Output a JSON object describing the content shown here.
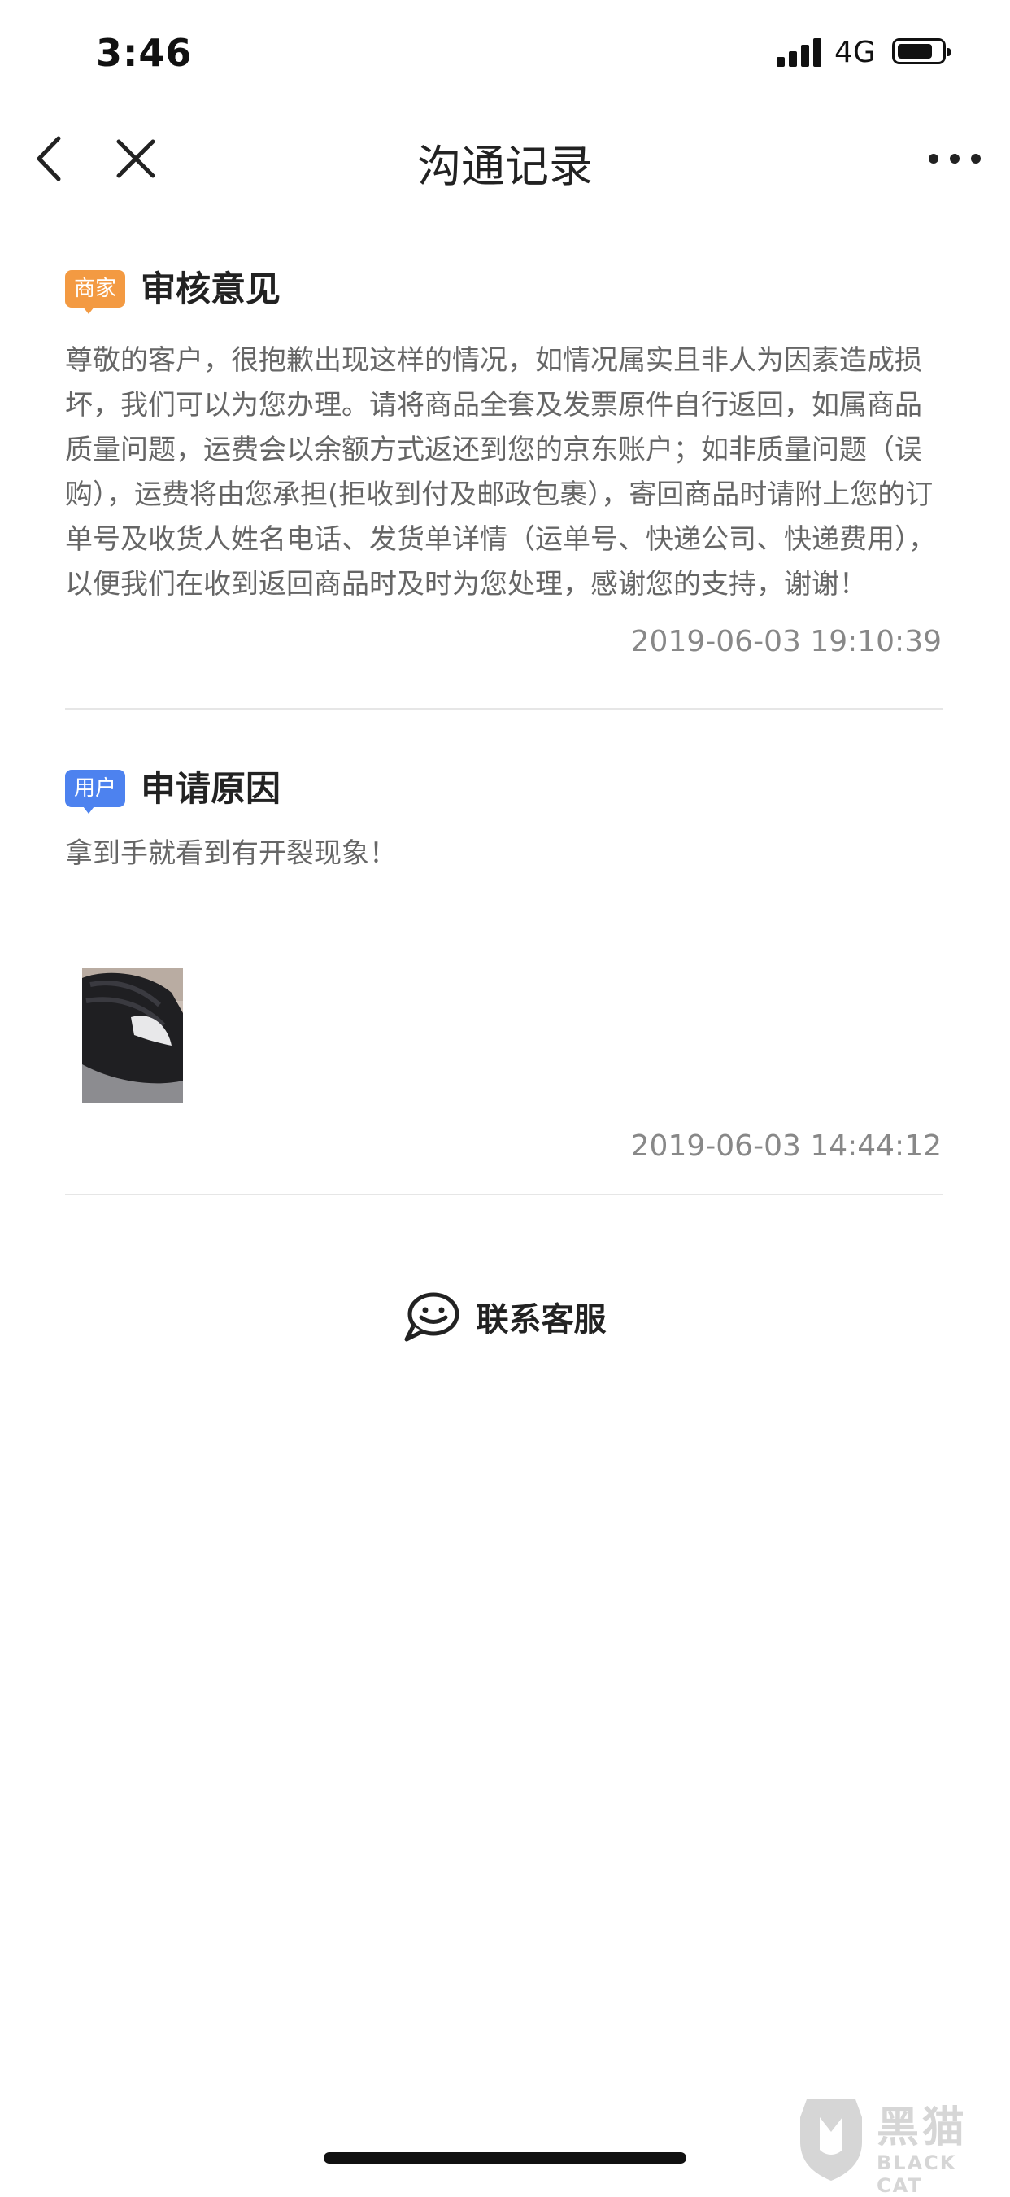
{
  "status_bar": {
    "time": "3:46",
    "network": "4G"
  },
  "nav": {
    "title": "沟通记录"
  },
  "merchant_section": {
    "tag": "商家",
    "title": "审核意见",
    "body": "尊敬的客户，很抱歉出现这样的情况，如情况属实且非人为因素造成损坏，我们可以为您办理。请将商品全套及发票原件自行返回，如属商品质量问题，运费会以余额方式返还到您的京东账户；如非质量问题（误购），运费将由您承担(拒收到付及邮政包裹），寄回商品时请附上您的订单号及收货人姓名电话、发货单详情（运单号、快递公司、快递费用），以便我们在收到返回商品时及时为您处理，感谢您的支持，谢谢！",
    "timestamp": "2019-06-03 19:10:39"
  },
  "user_section": {
    "tag": "用户",
    "title": "申请原因",
    "body": "拿到手就看到有开裂现象！",
    "timestamp": "2019-06-03 14:44:12"
  },
  "contact": {
    "label": "联系客服"
  },
  "watermark": {
    "text": "黑猫",
    "sub": "BLACK CAT"
  },
  "colors": {
    "merchant_tag": "#f39a42",
    "user_tag": "#4d82ef",
    "body_text": "#666666",
    "timestamp": "#888888"
  },
  "icons": [
    "back-icon",
    "close-icon",
    "more-icon",
    "chat-face-icon",
    "cat-logo-icon"
  ]
}
